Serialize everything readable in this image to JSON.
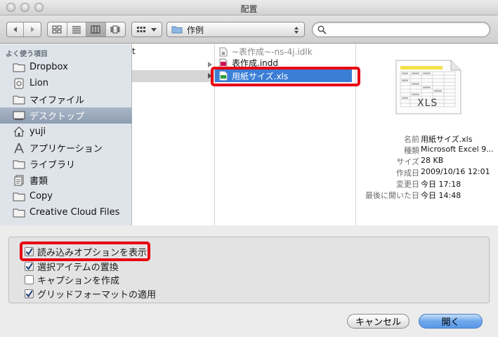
{
  "window": {
    "title": "配置"
  },
  "toolbar": {
    "back_icon": "chevron-left-icon",
    "forward_icon": "chevron-right-icon",
    "arrange_icon": "grid-dropdown-icon",
    "location": "作例",
    "search": {
      "value": "",
      "placeholder": ""
    }
  },
  "sidebar": {
    "header": "よく使う項目",
    "items": [
      {
        "label": "Dropbox",
        "icon": "folder-icon"
      },
      {
        "label": "Lion",
        "icon": "disk-icon"
      },
      {
        "label": "マイファイル",
        "icon": "folder-icon"
      },
      {
        "label": "デスクトップ",
        "icon": "desktop-icon"
      },
      {
        "label": "yuji",
        "icon": "home-icon"
      },
      {
        "label": "アプリケーション",
        "icon": "applications-icon"
      },
      {
        "label": "ライブラリ",
        "icon": "folder-icon"
      },
      {
        "label": "書類",
        "icon": "documents-icon"
      },
      {
        "label": "Copy",
        "icon": "folder-icon"
      },
      {
        "label": "Creative Cloud Files",
        "icon": "folder-icon"
      }
    ],
    "selected_index": 3
  },
  "column1": {
    "partial_text": "t"
  },
  "column2": {
    "files": [
      {
        "name": "~表作成~-ns-4j.idlk",
        "icon": "lock-file-icon",
        "dim": true
      },
      {
        "name": "表作成.indd",
        "icon": "indesign-file-icon",
        "dim": false
      },
      {
        "name": "用紙サイズ.xls",
        "icon": "excel-file-icon",
        "dim": false,
        "selected": true
      }
    ]
  },
  "preview": {
    "thumbnail_label": "XLS",
    "meta": [
      {
        "key": "名前",
        "value": "用紙サイズ.xls"
      },
      {
        "key": "種類",
        "value": "Microsoft Excel 9..."
      },
      {
        "key": "サイズ",
        "value": "28 KB"
      },
      {
        "key": "作成日",
        "value": "2009/10/16 12:01"
      },
      {
        "key": "変更日",
        "value": "今日 17:18"
      },
      {
        "key": "最後に開いた日",
        "value": "今日 14:48"
      }
    ]
  },
  "options": [
    {
      "label": "読み込みオプションを表示",
      "checked": true
    },
    {
      "label": "選択アイテムの置換",
      "checked": true
    },
    {
      "label": "キャプションを作成",
      "checked": false
    },
    {
      "label": "グリッドフォーマットの適用",
      "checked": true
    }
  ],
  "buttons": {
    "cancel": "キャンセル",
    "open": "開く"
  },
  "colors": {
    "highlight": "#e60012",
    "selection": "#3b7ed6",
    "primary_button": "#6ea8ec"
  }
}
